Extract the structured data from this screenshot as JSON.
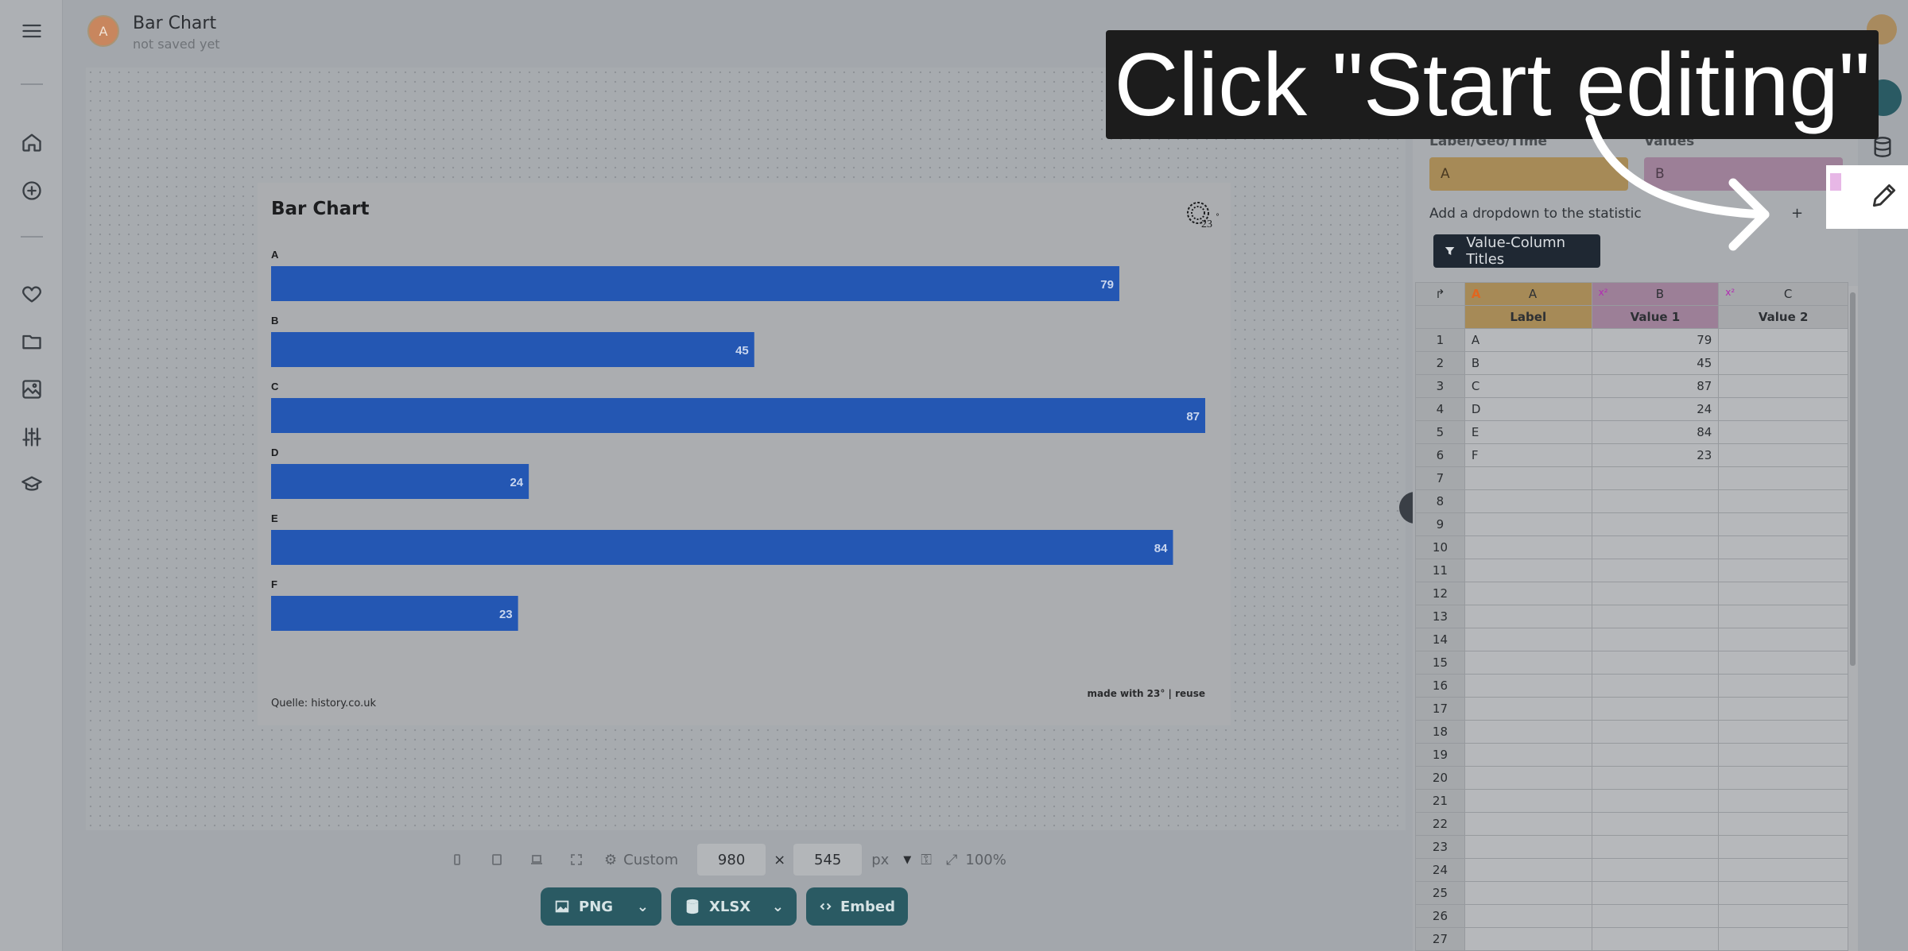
{
  "app": {
    "title": "Bar Chart",
    "subtitle": "not saved yet",
    "avatar_letter": "A"
  },
  "sidebar": {
    "items": [
      {
        "name": "menu-icon"
      },
      {
        "name": "home-icon"
      },
      {
        "name": "add-circle-icon"
      },
      {
        "name": "heart-icon"
      },
      {
        "name": "folder-icon"
      },
      {
        "name": "image-icon"
      },
      {
        "name": "sliders-icon"
      },
      {
        "name": "graduation-cap-icon"
      }
    ]
  },
  "chart_data": {
    "type": "bar",
    "orientation": "horizontal",
    "title": "Bar Chart",
    "categories": [
      "A",
      "B",
      "C",
      "D",
      "E",
      "F"
    ],
    "values": [
      79,
      45,
      87,
      24,
      84,
      23
    ],
    "xlabel": "",
    "ylabel": "",
    "xlim": [
      0,
      87
    ],
    "grid": false,
    "bar_color": "#2457b3",
    "source": "Quelle: history.co.uk",
    "credit": "made with 23° | reuse"
  },
  "chart_footer": {
    "source": "Quelle: history.co.uk",
    "credit": "made with 23° | reuse"
  },
  "size_bar": {
    "preset": "Custom",
    "width": "980",
    "times": "×",
    "height": "545",
    "unit": "px",
    "zoom": "100%"
  },
  "export": {
    "png": "PNG",
    "xlsx": "XLSX",
    "embed": "Embed"
  },
  "panel": {
    "label_col": "Label/Geo/Time",
    "values_col": "Values",
    "label_value": "A",
    "values_value": "B",
    "add_dropdown": "Add a dropdown to the statistic",
    "plus": "+",
    "filter_button": "Value-Column Titles"
  },
  "sheet": {
    "col_letters": [
      "A",
      "B",
      "C"
    ],
    "col_types": [
      "A",
      "x²",
      "x²"
    ],
    "headers": [
      "Label",
      "Value 1",
      "Value 2"
    ],
    "rows": [
      {
        "n": "1",
        "label": "A",
        "v1": "79",
        "v2": ""
      },
      {
        "n": "2",
        "label": "B",
        "v1": "45",
        "v2": ""
      },
      {
        "n": "3",
        "label": "C",
        "v1": "87",
        "v2": ""
      },
      {
        "n": "4",
        "label": "D",
        "v1": "24",
        "v2": ""
      },
      {
        "n": "5",
        "label": "E",
        "v1": "84",
        "v2": ""
      },
      {
        "n": "6",
        "label": "F",
        "v1": "23",
        "v2": ""
      },
      {
        "n": "7",
        "label": "",
        "v1": "",
        "v2": ""
      },
      {
        "n": "8",
        "label": "",
        "v1": "",
        "v2": ""
      },
      {
        "n": "9",
        "label": "",
        "v1": "",
        "v2": ""
      },
      {
        "n": "10",
        "label": "",
        "v1": "",
        "v2": ""
      },
      {
        "n": "11",
        "label": "",
        "v1": "",
        "v2": ""
      },
      {
        "n": "12",
        "label": "",
        "v1": "",
        "v2": ""
      },
      {
        "n": "13",
        "label": "",
        "v1": "",
        "v2": ""
      },
      {
        "n": "14",
        "label": "",
        "v1": "",
        "v2": ""
      },
      {
        "n": "15",
        "label": "",
        "v1": "",
        "v2": ""
      },
      {
        "n": "16",
        "label": "",
        "v1": "",
        "v2": ""
      },
      {
        "n": "17",
        "label": "",
        "v1": "",
        "v2": ""
      },
      {
        "n": "18",
        "label": "",
        "v1": "",
        "v2": ""
      },
      {
        "n": "19",
        "label": "",
        "v1": "",
        "v2": ""
      },
      {
        "n": "20",
        "label": "",
        "v1": "",
        "v2": ""
      },
      {
        "n": "21",
        "label": "",
        "v1": "",
        "v2": ""
      },
      {
        "n": "22",
        "label": "",
        "v1": "",
        "v2": ""
      },
      {
        "n": "23",
        "label": "",
        "v1": "",
        "v2": ""
      },
      {
        "n": "24",
        "label": "",
        "v1": "",
        "v2": ""
      },
      {
        "n": "25",
        "label": "",
        "v1": "",
        "v2": ""
      },
      {
        "n": "26",
        "label": "",
        "v1": "",
        "v2": ""
      },
      {
        "n": "27",
        "label": "",
        "v1": "",
        "v2": ""
      }
    ]
  },
  "tutorial": {
    "callout": "Click \"Start editing\""
  },
  "colors": {
    "accent": "#2a5a63",
    "bar": "#2457b3",
    "label_col": "#a68a57",
    "value_col": "#9c7f97"
  }
}
